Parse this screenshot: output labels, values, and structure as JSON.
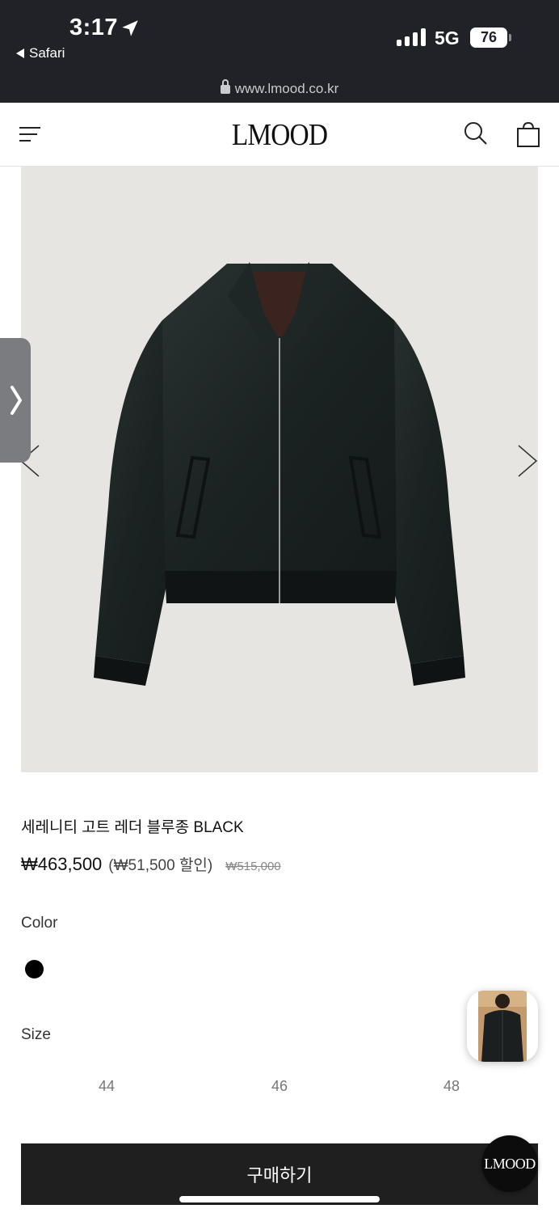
{
  "status_bar": {
    "time": "3:17",
    "back_label": "Safari",
    "network": "5G",
    "battery": "76",
    "url": "www.lmood.co.kr"
  },
  "header": {
    "logo": "LMOOD",
    "icons": [
      "menu-icon",
      "search-icon",
      "shopping-bag-icon"
    ]
  },
  "product": {
    "name": "세레니티 고트 레더 블루종 BLACK",
    "price": "₩463,500",
    "discount": "(₩51,500 할인)",
    "original_price": "₩515,000"
  },
  "options": {
    "color_label": "Color",
    "colors": [
      {
        "name": "black",
        "hex": "#000000"
      }
    ],
    "size_label": "Size",
    "sizes": [
      "44",
      "46",
      "48"
    ]
  },
  "actions": {
    "buy_label": "구매하기",
    "fab_label": "LMOOD"
  },
  "colors": {
    "status_bar_bg": "#202227",
    "buy_button_bg": "#1f1f1f",
    "gallery_bg": "#e6e5e1"
  }
}
